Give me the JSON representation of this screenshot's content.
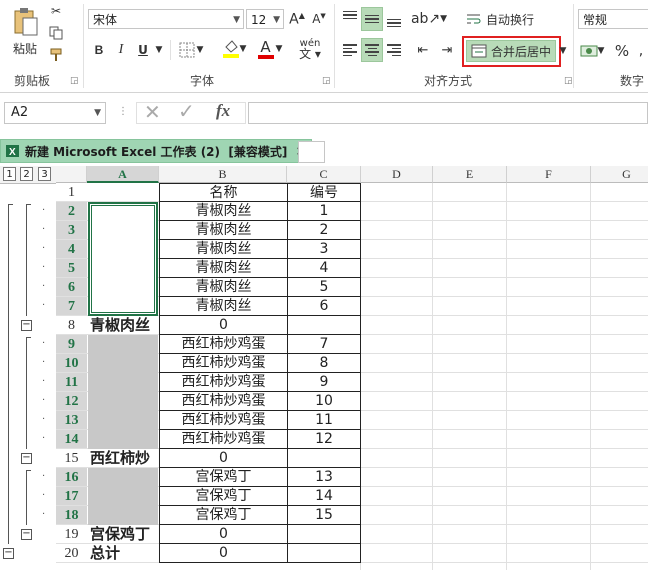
{
  "ribbon": {
    "clipboard": {
      "paste_label": "粘贴",
      "group_label": "剪贴板"
    },
    "font": {
      "font_name": "宋体",
      "font_size": "12",
      "bold": "B",
      "italic": "I",
      "underline": "U",
      "font_color_letter": "A",
      "phonetic": "wén",
      "group_label": "字体"
    },
    "alignment": {
      "wrap_text": "自动换行",
      "merge_center": "合并后居中",
      "group_label": "对齐方式"
    },
    "number": {
      "format": "常规",
      "percent": "%",
      "group_label": "数字"
    }
  },
  "formula_bar": {
    "name_box": "A2",
    "fx": "fx",
    "formula": ""
  },
  "workbook_tab": {
    "title": "新建 Microsoft Excel 工作表 (2)  [兼容模式]",
    "close": "×"
  },
  "outline_levels": [
    "1",
    "2",
    "3"
  ],
  "columns": [
    "A",
    "B",
    "C",
    "D",
    "E",
    "F",
    "G"
  ],
  "rows": [
    {
      "n": "1",
      "a": "",
      "b": "名称",
      "c": "编号"
    },
    {
      "n": "2",
      "a": "",
      "b": "青椒肉丝",
      "c": "1"
    },
    {
      "n": "3",
      "a": "",
      "b": "青椒肉丝",
      "c": "2"
    },
    {
      "n": "4",
      "a": "",
      "b": "青椒肉丝",
      "c": "3"
    },
    {
      "n": "5",
      "a": "",
      "b": "青椒肉丝",
      "c": "4"
    },
    {
      "n": "6",
      "a": "",
      "b": "青椒肉丝",
      "c": "5"
    },
    {
      "n": "7",
      "a": "",
      "b": "青椒肉丝",
      "c": "6"
    },
    {
      "n": "8",
      "a": "青椒肉丝",
      "b": "0",
      "c": ""
    },
    {
      "n": "9",
      "a": "",
      "b": "西红柿炒鸡蛋",
      "c": "7"
    },
    {
      "n": "10",
      "a": "",
      "b": "西红柿炒鸡蛋",
      "c": "8"
    },
    {
      "n": "11",
      "a": "",
      "b": "西红柿炒鸡蛋",
      "c": "9"
    },
    {
      "n": "12",
      "a": "",
      "b": "西红柿炒鸡蛋",
      "c": "10"
    },
    {
      "n": "13",
      "a": "",
      "b": "西红柿炒鸡蛋",
      "c": "11"
    },
    {
      "n": "14",
      "a": "",
      "b": "西红柿炒鸡蛋",
      "c": "12"
    },
    {
      "n": "15",
      "a": "西红柿炒",
      "b": "0",
      "c": ""
    },
    {
      "n": "16",
      "a": "",
      "b": "宫保鸡丁",
      "c": "13"
    },
    {
      "n": "17",
      "a": "",
      "b": "宫保鸡丁",
      "c": "14"
    },
    {
      "n": "18",
      "a": "",
      "b": "宫保鸡丁",
      "c": "15"
    },
    {
      "n": "19",
      "a": "宫保鸡丁",
      "b": "0",
      "c": ""
    },
    {
      "n": "20",
      "a": "总计",
      "b": "0",
      "c": ""
    }
  ],
  "colors": {
    "accent": "#217346",
    "selected_button": "#b8dbb8",
    "highlight_box": "#e02020",
    "tab_green": "#9fd5b3",
    "merged_gray": "#c8c8c8"
  }
}
